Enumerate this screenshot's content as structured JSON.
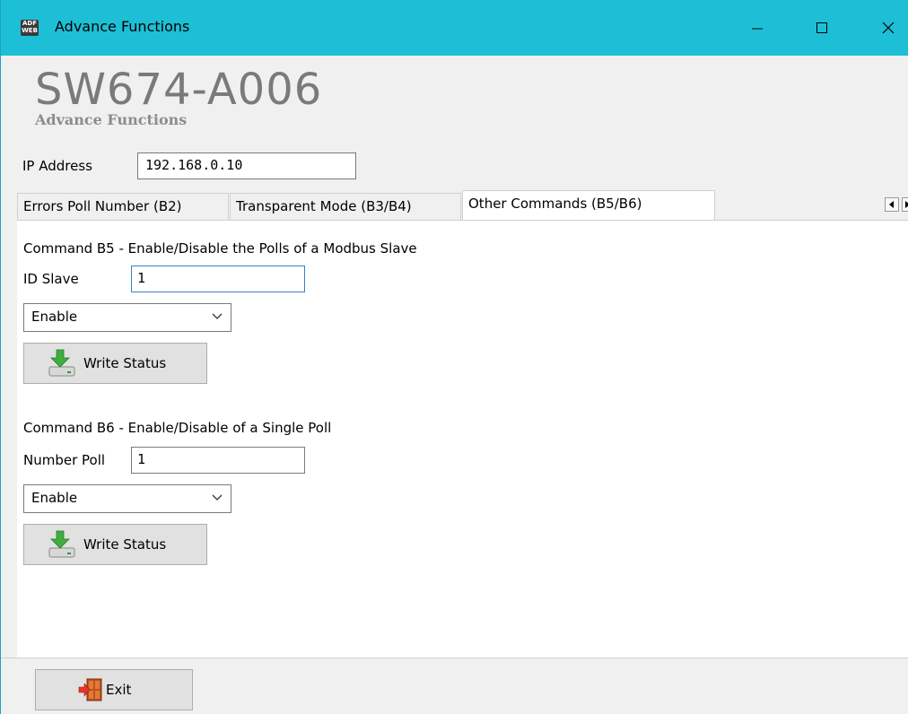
{
  "window": {
    "title": "Advance Functions",
    "app_icon_lines": [
      "ADF",
      "WEB"
    ]
  },
  "header": {
    "product": "SW674-A006",
    "subtitle": "Advance Functions"
  },
  "ip": {
    "label": "IP Address",
    "value": "192.168.0.10"
  },
  "tabs": [
    {
      "label": "Errors Poll Number (B2)"
    },
    {
      "label": "Transparent Mode (B3/B4)"
    },
    {
      "label": "Other Commands (B5/B6)"
    }
  ],
  "b5": {
    "heading": "Command B5 - Enable/Disable the Polls of a Modbus Slave",
    "field_label": "ID Slave",
    "field_value": "1",
    "select_value": "Enable",
    "button_label": "Write Status"
  },
  "b6": {
    "heading": "Command B6 - Enable/Disable of a Single Poll",
    "field_label": "Number Poll",
    "field_value": "1",
    "select_value": "Enable",
    "button_label": "Write Status"
  },
  "footer": {
    "exit_label": "Exit"
  },
  "icons": {
    "write": "download-arrow-icon",
    "exit": "exit-door-icon"
  },
  "colors": {
    "titlebar": "#1dbfd6",
    "accent_focus": "#3c7fc0"
  }
}
